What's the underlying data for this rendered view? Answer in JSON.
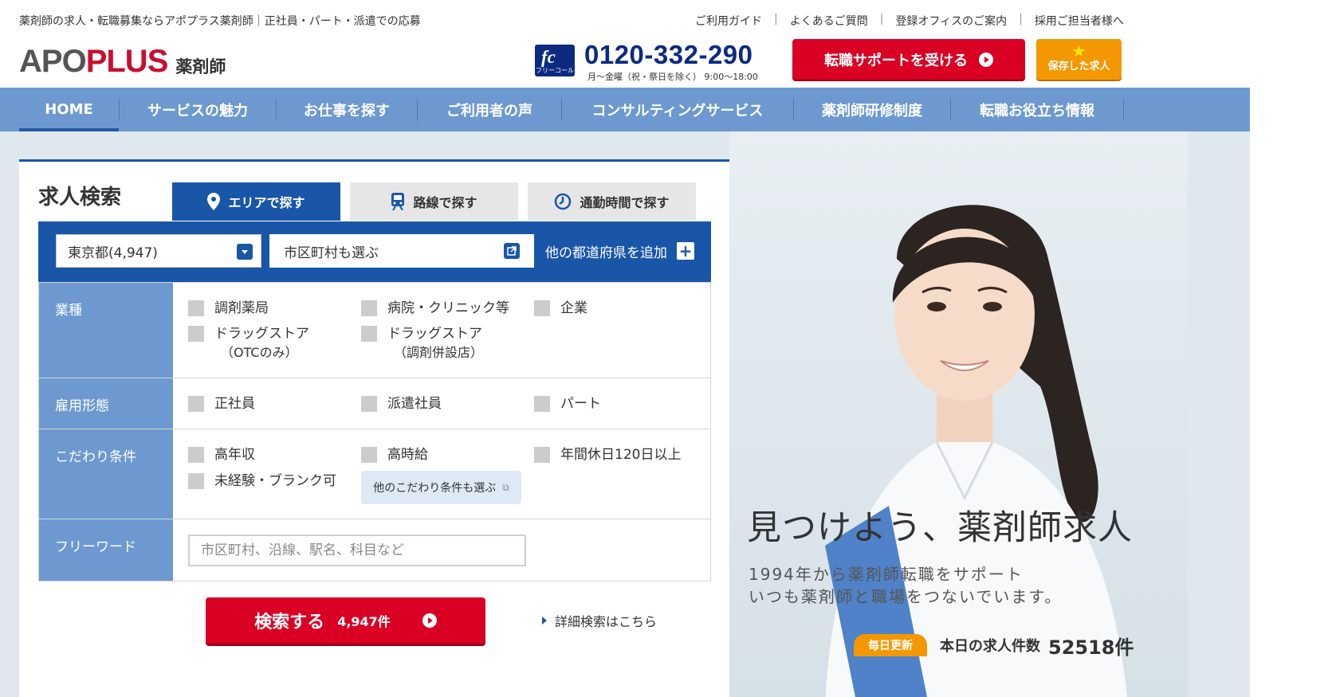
{
  "header": {
    "tagline": "薬剤師の求人・転職募集ならアポプラス薬剤師｜正社員・パート・派遣での応募",
    "top_links": [
      "ご利用ガイド",
      "よくあるご質問",
      "登録オフィスのご案内",
      "採用ご担当者様へ"
    ],
    "logo": {
      "apo": "APO",
      "plus": "PLUS",
      "sub": "薬剤師"
    },
    "phone": {
      "badge_text": "フリーコール",
      "number": "0120-332-290",
      "hours": "月〜金曜（祝・祭日を除く） 9:00〜18:00"
    },
    "support_button": "転職サポートを受ける",
    "saved_button": "保存した求人"
  },
  "nav": {
    "items": [
      "HOME",
      "サービスの魅力",
      "お仕事を探す",
      "ご利用者の声",
      "コンサルティングサービス",
      "薬剤師研修制度",
      "転職お役立ち情報"
    ]
  },
  "search": {
    "title": "求人検索",
    "tabs": [
      "エリアで探す",
      "路線で探す",
      "通勤時間で探す"
    ],
    "prefecture": "東京都(4,947)",
    "city": "市区町村も選ぶ",
    "add_prefecture": "他の都道府県を追加",
    "rows": {
      "industry": {
        "label": "業種",
        "options": [
          "調剤薬局",
          "病院・クリニック等",
          "企業",
          "ドラッグストア",
          "ドラッグストア"
        ],
        "subs": [
          "（OTCのみ）",
          "（調剤併設店）"
        ]
      },
      "employment": {
        "label": "雇用形態",
        "options": [
          "正社員",
          "派遣社員",
          "パート"
        ]
      },
      "conditions": {
        "label": "こだわり条件",
        "options": [
          "高年収",
          "高時給",
          "年間休日120日以上",
          "未経験・ブランク可"
        ],
        "more": "他のこだわり条件も選ぶ"
      },
      "freeword": {
        "label": "フリーワード",
        "placeholder": "市区町村、沿線、駅名、科目など"
      }
    },
    "search_button": "検索する",
    "search_count": "4,947件",
    "detail_link": "詳細検索はこちら"
  },
  "hero": {
    "title": "見つけよう、薬剤師求人",
    "line1": "1994年から薬剤師転職をサポート",
    "line2": "いつも薬剤師と職場をつないでいます。",
    "badge": "毎日更新",
    "count_label": "本日の求人件数",
    "count": "52518件"
  },
  "colors": {
    "brand_red": "#d90023",
    "brand_blue": "#1a56a8",
    "nav_blue": "#6d99d0",
    "accent_orange": "#f39800"
  }
}
